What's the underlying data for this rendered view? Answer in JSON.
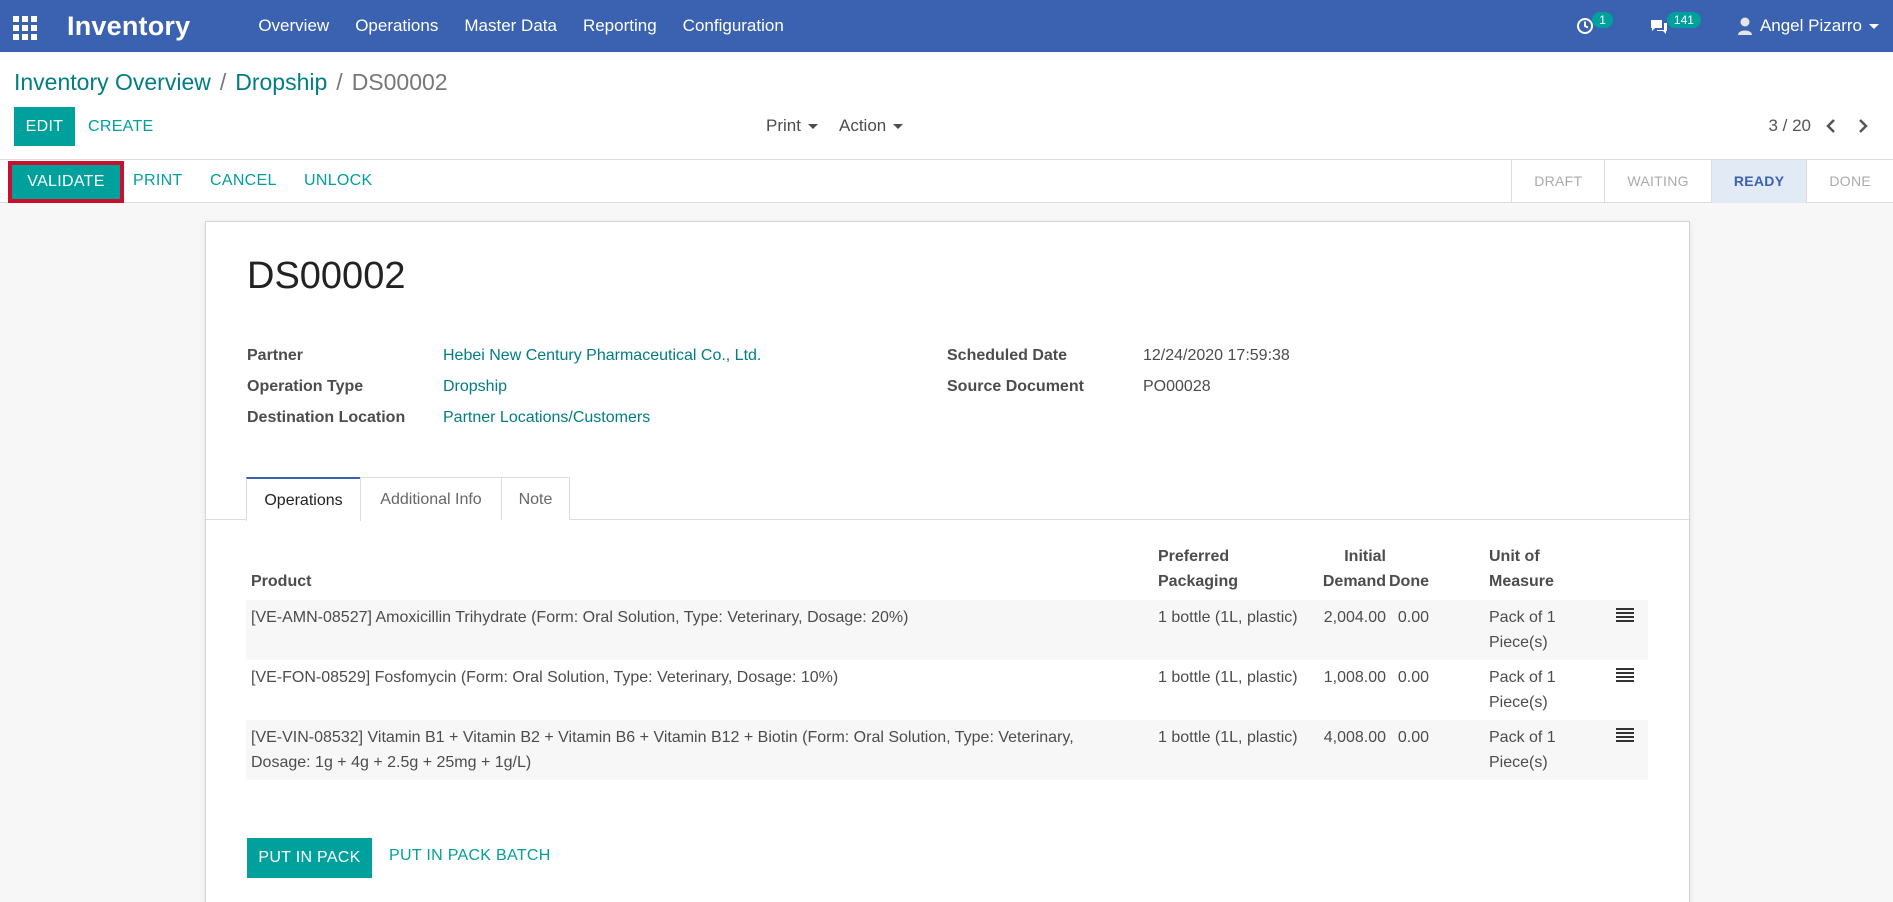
{
  "app": {
    "title": "Inventory",
    "menu": [
      "Overview",
      "Operations",
      "Master Data",
      "Reporting",
      "Configuration"
    ],
    "activity_count": "1",
    "message_count": "141",
    "user_name": "Angel Pizarro",
    "nav_color": "#3a62b0",
    "accent_color": "#00a09d"
  },
  "breadcrumb": {
    "items": [
      "Inventory Overview",
      "Dropship"
    ],
    "current": "DS00002",
    "separator": "/"
  },
  "toolbar": {
    "edit_label": "EDIT",
    "create_label": "CREATE",
    "print_label": "Print",
    "action_label": "Action",
    "pager": "3 / 20"
  },
  "header": {
    "validate_label": "VALIDATE",
    "print_label": "PRINT",
    "cancel_label": "CANCEL",
    "unlock_label": "UNLOCK",
    "stages": [
      "DRAFT",
      "WAITING",
      "READY",
      "DONE"
    ],
    "active_stage": "READY"
  },
  "record": {
    "name": "DS00002",
    "fields": {
      "partner_label": "Partner",
      "partner_value": "Hebei New Century Pharmaceutical Co., Ltd.",
      "operation_type_label": "Operation Type",
      "operation_type_value": "Dropship",
      "destination_label": "Destination Location",
      "destination_value": "Partner Locations/Customers",
      "scheduled_date_label": "Scheduled Date",
      "scheduled_date_value": "12/24/2020 17:59:38",
      "source_document_label": "Source Document",
      "source_document_value": "PO00028"
    }
  },
  "tabs": [
    "Operations",
    "Additional Info",
    "Note"
  ],
  "operations_table": {
    "columns": {
      "product": "Product",
      "packaging_1": "Preferred",
      "packaging_2": "Packaging",
      "demand_1": "Initial",
      "demand_2": "Demand",
      "done": "Done",
      "uom_1": "Unit of",
      "uom_2": "Measure"
    },
    "rows": [
      {
        "product_1": "[VE-AMN-08527] Amoxicillin Trihydrate (Form: Oral Solution, Type: Veterinary, Dosage: 20%)",
        "product_2": "",
        "packaging": "1 bottle (1L, plastic)",
        "demand": "2,004.00",
        "done": "0.00",
        "uom_1": "Pack of 1",
        "uom_2": "Piece(s)"
      },
      {
        "product_1": "[VE-FON-08529] Fosfomycin (Form: Oral Solution, Type: Veterinary, Dosage: 10%)",
        "product_2": "",
        "packaging": "1 bottle (1L, plastic)",
        "demand": "1,008.00",
        "done": "0.00",
        "uom_1": "Pack of 1",
        "uom_2": "Piece(s)"
      },
      {
        "product_1": "[VE-VIN-08532] Vitamin B1 + Vitamin B2 + Vitamin B6 + Vitamin B12 + Biotin (Form: Oral Solution, Type: Veterinary,",
        "product_2": "Dosage: 1g + 4g + 2.5g + 25mg + 1g/L)",
        "packaging": "1 bottle (1L, plastic)",
        "demand": "4,008.00",
        "done": "0.00",
        "uom_1": "Pack of 1",
        "uom_2": "Piece(s)"
      }
    ]
  },
  "footer_buttons": {
    "put_in_pack": "PUT IN PACK",
    "put_in_pack_batch": "PUT IN PACK BATCH"
  }
}
